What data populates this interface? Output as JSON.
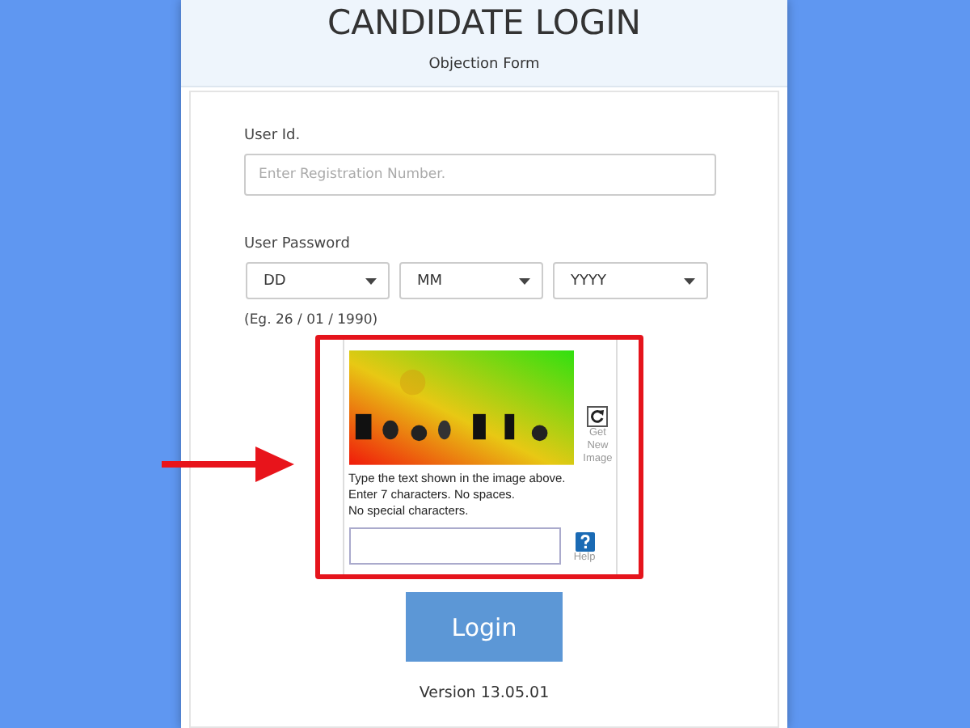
{
  "title": "CANDIDATE LOGIN",
  "subtitle": "Objection Form",
  "user_id": {
    "label": "User Id.",
    "placeholder": "Enter Registration Number."
  },
  "password": {
    "label": "User Password",
    "selects": [
      "DD",
      "MM",
      "YYYY"
    ],
    "hint": "(Eg. 26 / 01 / 1990)"
  },
  "captcha": {
    "refresh_label": "Get New Image",
    "instructions": [
      "Type the text shown in the image above.",
      "Enter 7 characters. No spaces.",
      "No special characters."
    ],
    "help_label": "Help"
  },
  "login_button": "Login",
  "version": "Version 13.05.01"
}
